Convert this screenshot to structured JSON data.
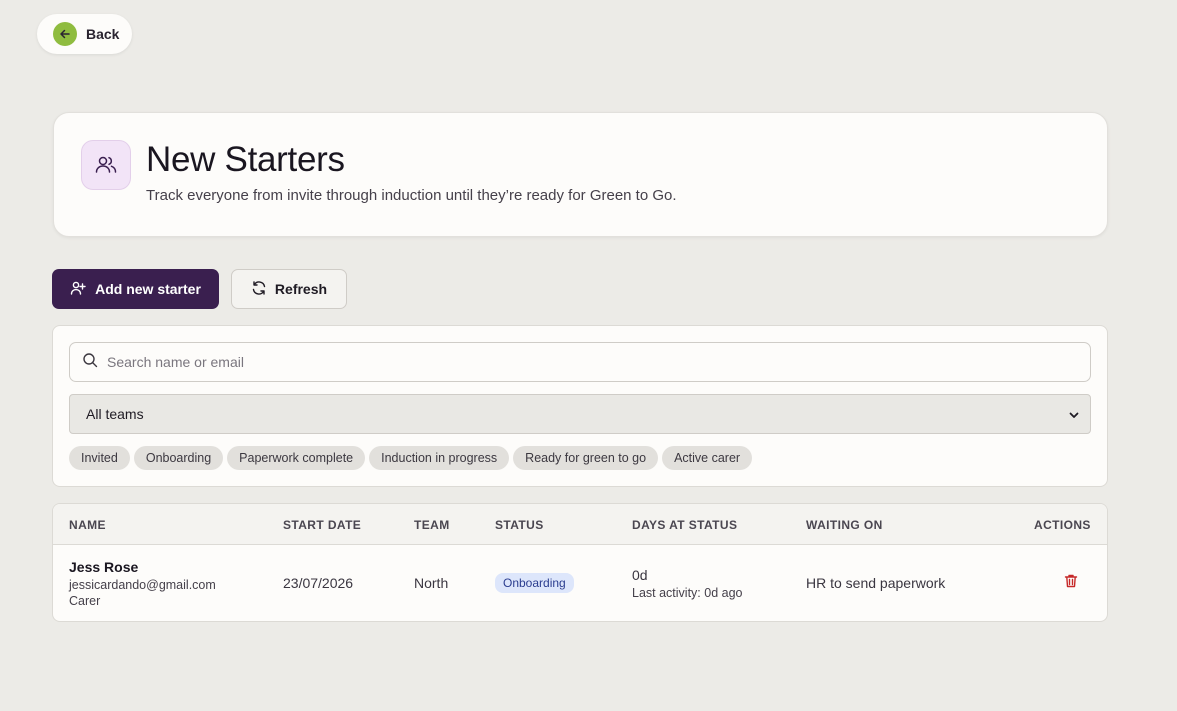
{
  "nav": {
    "back_label": "Back"
  },
  "header": {
    "icon": "users-icon",
    "title": "New Starters",
    "subtitle": "Track everyone from invite through induction until they’re ready for Green to Go."
  },
  "toolbar": {
    "add_label": "Add new starter",
    "refresh_label": "Refresh"
  },
  "filters": {
    "search_placeholder": "Search name or email",
    "team_selected": "All teams",
    "status_chips": [
      "Invited",
      "Onboarding",
      "Paperwork complete",
      "Induction in progress",
      "Ready for green to go",
      "Active carer"
    ]
  },
  "table": {
    "columns": [
      "NAME",
      "START DATE",
      "TEAM",
      "STATUS",
      "DAYS AT STATUS",
      "WAITING ON",
      "ACTIONS"
    ],
    "rows": [
      {
        "name": "Jess Rose",
        "email": "jessicardando@gmail.com",
        "role": "Carer",
        "start_date": "23/07/2026",
        "team": "North",
        "status": "Onboarding",
        "days": "0d",
        "last_activity": "Last activity: 0d ago",
        "waiting_on": "HR to send paperwork"
      }
    ]
  },
  "colors": {
    "primary": "#3a1f4f",
    "back_accent": "#8fbc3f",
    "status_badge_bg": "#dde6fb",
    "delete": "#c62828"
  }
}
